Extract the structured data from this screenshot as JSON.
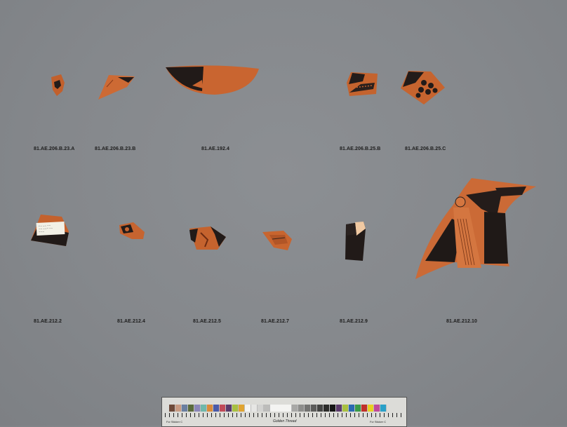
{
  "specimens": [
    {
      "id": "a",
      "label": "81.AE.206.B.23.A"
    },
    {
      "id": "b",
      "label": "81.AE.206.B.23.B"
    },
    {
      "id": "c",
      "label": "81.AE.192.4"
    },
    {
      "id": "d",
      "label": "81.AE.206.B.25.B"
    },
    {
      "id": "e",
      "label": "81.AE.206.B.25.C"
    },
    {
      "id": "f",
      "label": "81.AE.212.2"
    },
    {
      "id": "g",
      "label": "81.AE.212.4"
    },
    {
      "id": "h",
      "label": "81.AE.212.5"
    },
    {
      "id": "i",
      "label": "81.AE.212.7"
    },
    {
      "id": "j",
      "label": "81.AE.212.9"
    },
    {
      "id": "k",
      "label": "81.AE.212.10"
    }
  ],
  "colors": {
    "background": "#85888c",
    "terracotta": "#c9652f",
    "black_glaze": "#1e1a19"
  },
  "color_bar": {
    "brand": "Golden Thread",
    "left_text": "Fcr Sticker C",
    "right_text": "Fcr Sticker C"
  }
}
